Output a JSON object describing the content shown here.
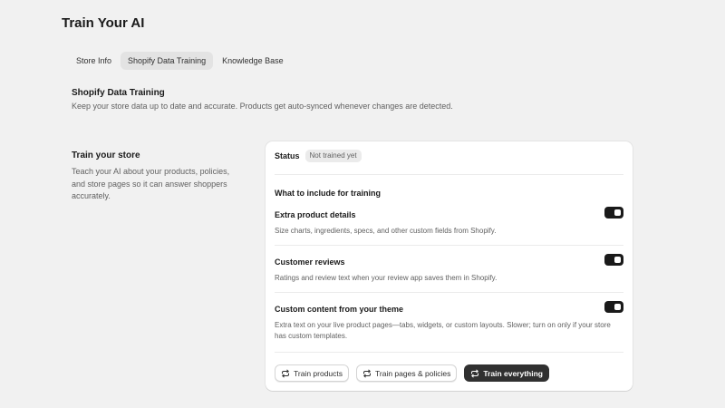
{
  "page": {
    "title": "Train Your AI"
  },
  "tabs": [
    {
      "label": "Store Info",
      "active": false
    },
    {
      "label": "Shopify Data Training",
      "active": true
    },
    {
      "label": "Knowledge Base",
      "active": false
    }
  ],
  "section": {
    "title": "Shopify Data Training",
    "description": "Keep your store data up to date and accurate. Products get auto-synced whenever changes are detected."
  },
  "side": {
    "title": "Train your store",
    "description": "Teach your AI about your products, policies, and store pages so it can answer shoppers accurately."
  },
  "card": {
    "status_label": "Status",
    "status_value": "Not trained yet",
    "include_title": "What to include for training",
    "options": [
      {
        "title": "Extra product details",
        "description": "Size charts, ingredients, specs, and other custom fields from Shopify.",
        "enabled": true
      },
      {
        "title": "Customer reviews",
        "description": "Ratings and review text when your review app saves them in Shopify.",
        "enabled": true
      },
      {
        "title": "Custom content from your theme",
        "description": "Extra text on your live product pages—tabs, widgets, or custom layouts. Slower; turn on only if your store has custom templates.",
        "enabled": true
      }
    ],
    "buttons": {
      "train_products": "Train products",
      "train_pages": "Train pages & policies",
      "train_everything": "Train everything"
    }
  },
  "icons": {
    "refresh": "refresh-icon"
  },
  "colors": {
    "primary_button": "#303030",
    "toggle_on": "#1a1a1a",
    "background": "#f1f1f1"
  }
}
